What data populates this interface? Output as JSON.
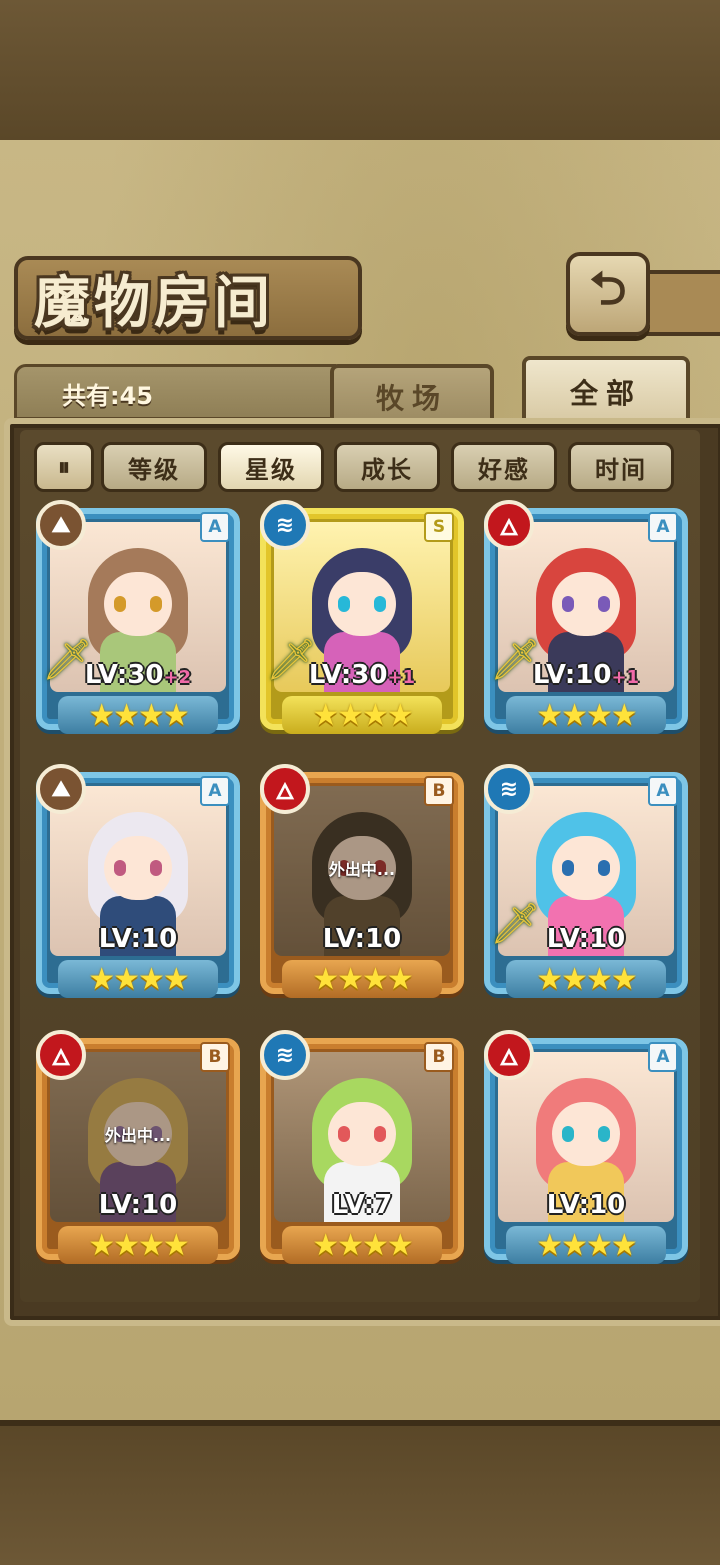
{
  "header": {
    "title": "魔物房间",
    "back_icon": "back-arrow-icon"
  },
  "summary": {
    "count_label": "共有:45"
  },
  "tabs": [
    {
      "label": "牧场",
      "active": false
    },
    {
      "label": "全部",
      "active": true
    }
  ],
  "sort": {
    "toggle_icon": "sort-order-icon",
    "options": [
      {
        "label": "等级",
        "active": false
      },
      {
        "label": "星级",
        "active": true
      },
      {
        "label": "成长",
        "active": false
      },
      {
        "label": "好感",
        "active": false
      },
      {
        "label": "时间",
        "active": false
      }
    ]
  },
  "monsters": [
    {
      "element": "earth",
      "rank": "A",
      "level": "LV:30",
      "plus": "+2",
      "stars": "★★★★",
      "weapon": true,
      "away": false,
      "hair": "#a57a5a",
      "eye": "#d49a2a",
      "body": "#a9c77a"
    },
    {
      "element": "water",
      "rank": "S",
      "level": "LV:30",
      "plus": "+1",
      "stars": "★★★★",
      "weapon": true,
      "away": false,
      "hair": "#3a3d68",
      "eye": "#27b8d8",
      "body": "#d662b9"
    },
    {
      "element": "fire",
      "rank": "A",
      "level": "LV:10",
      "plus": "+1",
      "stars": "★★★★",
      "weapon": true,
      "away": false,
      "hair": "#d8453e",
      "eye": "#7a5ab8",
      "body": "#3b3a5a"
    },
    {
      "element": "earth",
      "rank": "A",
      "level": "LV:10",
      "plus": "",
      "stars": "★★★★",
      "weapon": false,
      "away": false,
      "hair": "#ece8f0",
      "eye": "#c05a80",
      "body": "#2f4c7a"
    },
    {
      "element": "fire",
      "rank": "B",
      "level": "LV:10",
      "plus": "",
      "stars": "★★★★",
      "weapon": false,
      "away": true,
      "away_text": "外出中...",
      "hair": "#2f2820",
      "eye": "#a8212a",
      "body": "#5a4a32"
    },
    {
      "element": "water",
      "rank": "A",
      "level": "LV:10",
      "plus": "",
      "stars": "★★★★",
      "weapon": true,
      "away": false,
      "hair": "#4fc2e8",
      "eye": "#2a6fb0",
      "body": "#f272b0"
    },
    {
      "element": "fire",
      "rank": "B",
      "level": "LV:10",
      "plus": "",
      "stars": "★★★★",
      "weapon": false,
      "away": true,
      "away_text": "外出中...",
      "hair": "#d8b25a",
      "eye": "#8a6ab0",
      "body": "#6a4a8a"
    },
    {
      "element": "water",
      "rank": "B",
      "level": "LV:7",
      "plus": "",
      "stars": "★★★★",
      "weapon": false,
      "away": false,
      "hair": "#a8d860",
      "eye": "#e2585a",
      "body": "#f3f3f3"
    },
    {
      "element": "fire",
      "rank": "A",
      "level": "LV:10",
      "plus": "",
      "stars": "★★★★",
      "weapon": false,
      "away": false,
      "hair": "#f07b7b",
      "eye": "#2ab5c9",
      "body": "#f1c85a"
    }
  ]
}
